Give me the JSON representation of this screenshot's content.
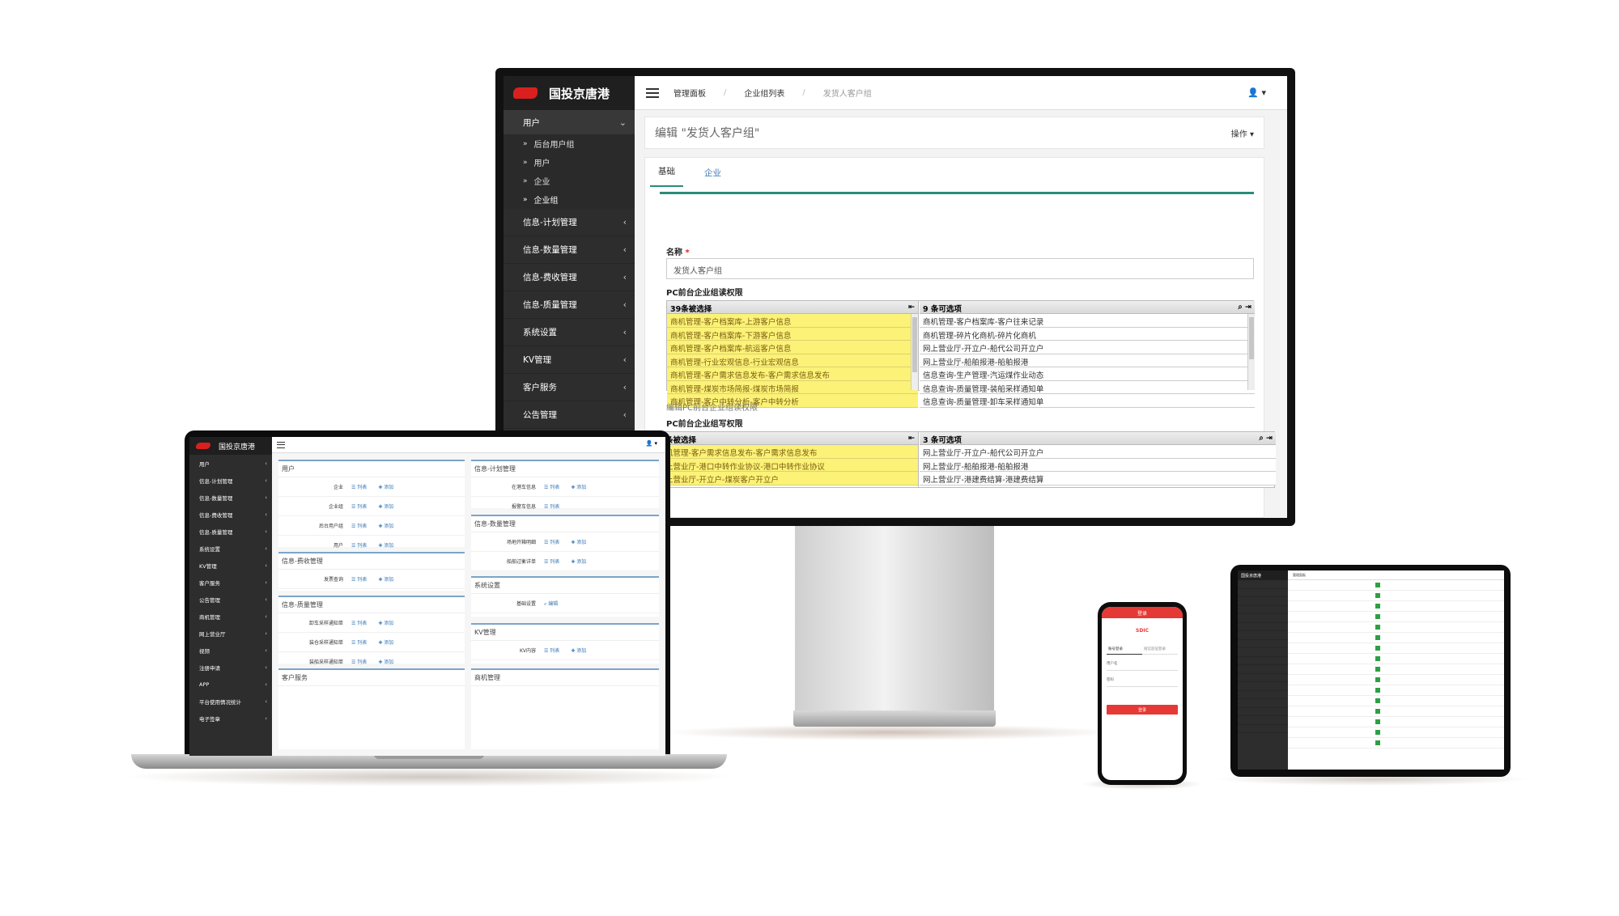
{
  "monitor": {
    "logo": "国投京唐港",
    "sidebar": {
      "open_group": "用户",
      "sub_items": [
        "后台用户组",
        "用户",
        "企业",
        "企业组"
      ],
      "items": [
        "信息-计划管理",
        "信息-数量管理",
        "信息-费收管理",
        "信息-质量管理",
        "系统设置",
        "KV管理",
        "客户服务",
        "公告管理"
      ]
    },
    "breadcrumb": [
      "管理面板",
      "企业组列表",
      "发货人客户组"
    ],
    "header": {
      "title": "编辑 \"发货人客户组\"",
      "ops": "操作"
    },
    "tabs": [
      "基础",
      "企业"
    ],
    "form": {
      "name_label": "名称",
      "name_value": "发货人客户组",
      "read_label": "PC前台企业组读权限",
      "read_selected_header": "39条被选择",
      "read_selected": [
        "商机管理-客户档案库-上游客户信息",
        "商机管理-客户档案库-下游客户信息",
        "商机管理-客户档案库-航运客户信息",
        "商机管理-行业宏观信息-行业宏观信息",
        "商机管理-客户需求信息发布-客户需求信息发布",
        "商机管理-煤炭市场简报-煤炭市场简报",
        "商机管理-客户中转分析-客户中转分析"
      ],
      "read_options_header": "9 条可选项",
      "read_options": [
        "商机管理-客户档案库-客户往来记录",
        "商机管理-碎片化商机-碎片化商机",
        "网上营业厅-开立户-船代公司开立户",
        "网上营业厅-船舶报港-船舶报港",
        "信息查询-生产管理-汽运煤作业动态",
        "信息查询-质量管理-装船采样通知单",
        "信息查询-质量管理-卸车采样通知单"
      ],
      "read_note": "编辑PC前台企业组读权限",
      "write_label": "PC前台企业组写权限",
      "write_selected_header": "条被选择",
      "write_selected": [
        "机管理-客户需求信息发布-客户需求信息发布",
        "上营业厅-港口中转作业协议-港口中转作业协议",
        "上营业厅-开立户-煤炭客户开立户"
      ],
      "write_options_header": "3 条可选项",
      "write_options": [
        "网上营业厅-开立户-船代公司开立户",
        "网上营业厅-船舶报港-船舶报港",
        "网上营业厅-港建费结算-港建费结算"
      ]
    }
  },
  "laptop": {
    "logo": "国投京唐港",
    "sidebar": [
      "用户",
      "信息-计划管理",
      "信息-数量管理",
      "信息-费收管理",
      "信息-质量管理",
      "系统设置",
      "KV管理",
      "客户服务",
      "公告管理",
      "商机管理",
      "网上营业厅",
      "视频",
      "注册申请",
      "APP",
      "平台使用情况统计",
      "电子签章"
    ],
    "list_label": "列表",
    "add_label": "添加",
    "edit_label": "编辑",
    "panels": {
      "user": {
        "title": "用户",
        "rows": [
          "企业",
          "企业组",
          "后台用户组",
          "用户"
        ]
      },
      "fee": {
        "title": "信息-费收管理",
        "rows": [
          "发票查询"
        ]
      },
      "quality": {
        "title": "信息-质量管理",
        "rows": [
          "卸车采样通知单",
          "装仓采样通知单",
          "装船采样通知单"
        ]
      },
      "service": {
        "title": "客户服务"
      },
      "plan": {
        "title": "信息-计划管理",
        "rows": [
          "在港车信息",
          "报警车信息"
        ]
      },
      "quantity": {
        "title": "信息-数量管理",
        "rows": [
          "场地开箱明细",
          "船舶过衡详单"
        ]
      },
      "system": {
        "title": "系统设置",
        "rows": [
          "基础设置"
        ]
      },
      "kv": {
        "title": "KV管理",
        "rows": [
          "KV内容"
        ]
      },
      "biz": {
        "title": "商机管理"
      }
    }
  },
  "phone": {
    "bar": "登录",
    "logo": "SDIC",
    "tabs": [
      "账号登录",
      "短信验证登录"
    ],
    "fields": [
      "用户名",
      "密码"
    ],
    "button": "登录"
  },
  "tablet": {
    "logo": "国投京唐港",
    "top": "管理面板"
  },
  "colors": {
    "brand_red": "#d9201e",
    "sidebar_dark": "#2d2d2d",
    "accent_teal": "#2a8c77",
    "selected_yellow": "#fbf277",
    "link_blue": "#3a7ab8"
  }
}
